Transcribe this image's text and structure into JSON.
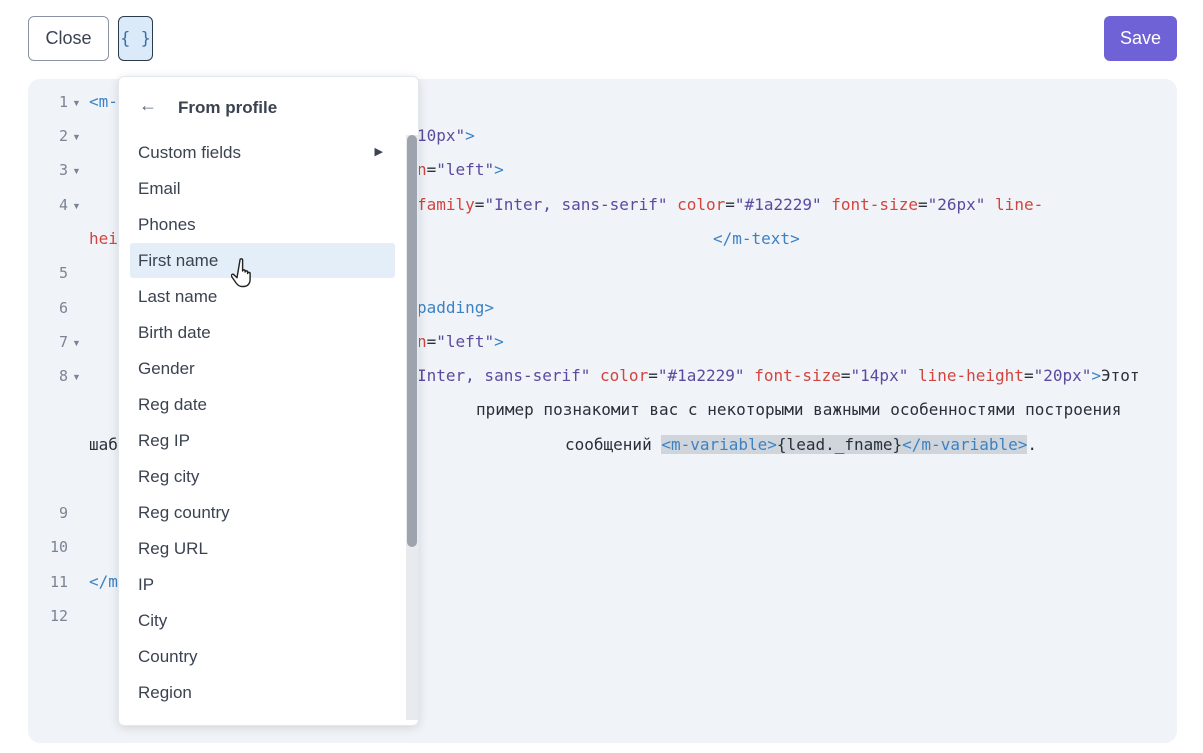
{
  "toolbar": {
    "close_label": "Close",
    "vars_label": "{ }",
    "save_label": "Save"
  },
  "editor": {
    "line_numbers": [
      "1",
      "2",
      "3",
      "4",
      "5",
      "6",
      "7",
      "8",
      "9",
      "10",
      "11",
      "12"
    ],
    "lines": [
      {
        "key": "l1",
        "parts": [
          {
            "c": "tag",
            "t": "<m-"
          }
        ]
      },
      {
        "key": "l2",
        "parts": [
          {
            "c": "val",
            "t": "10px\""
          },
          {
            "c": "tag",
            "t": ">"
          }
        ]
      },
      {
        "key": "l3",
        "parts": [
          {
            "c": "attr",
            "t": "n"
          },
          {
            "c": "",
            "t": "="
          },
          {
            "c": "val",
            "t": "\"left\""
          },
          {
            "c": "tag",
            "t": ">"
          }
        ]
      },
      {
        "key": "l4",
        "parts": [
          {
            "c": "attr",
            "t": "family"
          },
          {
            "c": "",
            "t": "="
          },
          {
            "c": "val",
            "t": "\"Inter, sans-serif\""
          },
          {
            "c": "",
            "t": " "
          },
          {
            "c": "attr",
            "t": "color"
          },
          {
            "c": "",
            "t": "="
          },
          {
            "c": "val",
            "t": "\"#1a2229\""
          },
          {
            "c": "",
            "t": " "
          },
          {
            "c": "attr",
            "t": "font-size"
          },
          {
            "c": "",
            "t": "="
          },
          {
            "c": "val",
            "t": "\"26px\""
          },
          {
            "c": "",
            "t": " "
          },
          {
            "c": "attr",
            "t": "line-"
          }
        ]
      },
      {
        "key": "l4b",
        "parts": [
          {
            "c": "attr",
            "t": "hei"
          }
        ]
      },
      {
        "key": "l4c",
        "parts": [
          {
            "c": "tag",
            "t": "</m-text>"
          }
        ]
      },
      {
        "key": "l6",
        "parts": [
          {
            "c": "tag",
            "t": "padding>"
          }
        ]
      },
      {
        "key": "l7",
        "parts": [
          {
            "c": "attr",
            "t": "n"
          },
          {
            "c": "",
            "t": "="
          },
          {
            "c": "val",
            "t": "\"left\""
          },
          {
            "c": "tag",
            "t": ">"
          }
        ]
      },
      {
        "key": "l8",
        "parts": [
          {
            "c": "val",
            "t": "Inter, sans-serif\""
          },
          {
            "c": "",
            "t": " "
          },
          {
            "c": "attr",
            "t": "color"
          },
          {
            "c": "",
            "t": "="
          },
          {
            "c": "val",
            "t": "\"#1a2229\""
          },
          {
            "c": "",
            "t": " "
          },
          {
            "c": "attr",
            "t": "font-size"
          },
          {
            "c": "",
            "t": "="
          },
          {
            "c": "val",
            "t": "\"14px\""
          },
          {
            "c": "",
            "t": " "
          },
          {
            "c": "attr",
            "t": "line-height"
          },
          {
            "c": "",
            "t": "="
          },
          {
            "c": "val",
            "t": "\"20px\""
          },
          {
            "c": "tag",
            "t": ">"
          },
          {
            "c": "",
            "t": "Этот"
          }
        ]
      },
      {
        "key": "l8b",
        "parts": [
          {
            "c": "",
            "t": "пример познакомит вас с некоторыми важными особенностями построения"
          }
        ]
      },
      {
        "key": "l8c",
        "parts": [
          {
            "c": "",
            "t": "шаб"
          }
        ]
      },
      {
        "key": "l8d",
        "parts": [
          {
            "c": "",
            "t": "сообщений "
          },
          {
            "c": "tag hl",
            "t": "<m-variable>"
          },
          {
            "c": "hl",
            "t": "{lead._fname}"
          },
          {
            "c": "tag hl",
            "t": "</m-variable>"
          },
          {
            "c": "",
            "t": "."
          }
        ]
      },
      {
        "key": "l11",
        "parts": [
          {
            "c": "tag",
            "t": "</m"
          }
        ]
      }
    ]
  },
  "menu": {
    "title": "From profile",
    "items": [
      "Custom fields",
      "Email",
      "Phones",
      "First name",
      "Last name",
      "Birth date",
      "Gender",
      "Reg date",
      "Reg IP",
      "Reg city",
      "Reg country",
      "Reg URL",
      "IP",
      "City",
      "Country",
      "Region"
    ]
  },
  "icons": {
    "back": "arrow-left-icon",
    "submenu": "caret-right-icon",
    "cursor": "hand-pointer-icon"
  },
  "colors": {
    "accent": "#6e62d6",
    "tag": "#3b82c4",
    "attr": "#d2443e",
    "value": "#5a4aa0",
    "hover": "#e4eef8"
  }
}
